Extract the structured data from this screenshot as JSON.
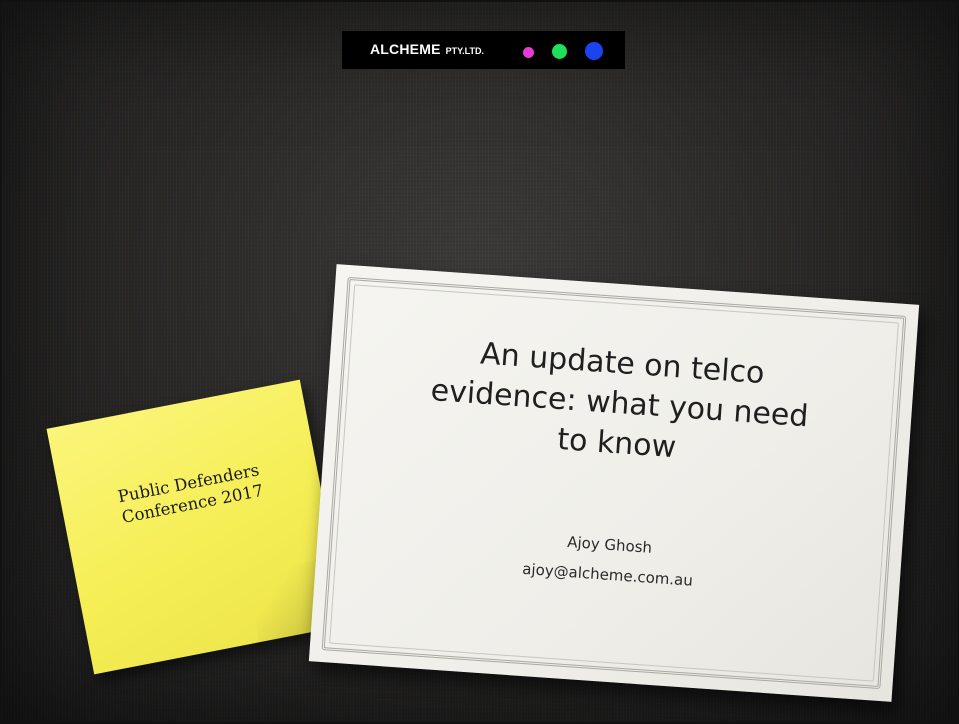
{
  "logo": {
    "name": "ALCHEME",
    "suffix": "PTY.LTD.",
    "dots": {
      "magenta": "#e63bd6",
      "green": "#1ee05a",
      "blue": "#1a44f0"
    }
  },
  "sticky_note": {
    "line1": "Public Defenders",
    "line2": "Conference 2017"
  },
  "title_card": {
    "title_line1": "An update on telco",
    "title_line2": "evidence: what you need",
    "title_line3": "to know",
    "author": "Ajoy Ghosh",
    "email": "ajoy@alcheme.com.au"
  },
  "colors": {
    "background": "#2a2928",
    "sticky": "#f5ee55",
    "paper": "#f1f0eb"
  }
}
